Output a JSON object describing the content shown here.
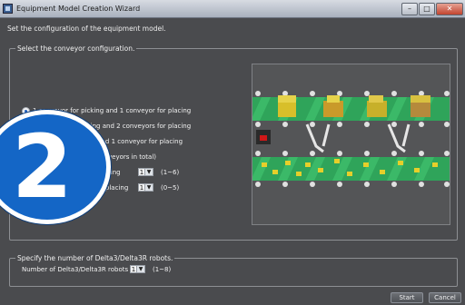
{
  "window": {
    "title": "Equipment Model Creation Wizard",
    "controls": [
      "–",
      "□",
      "✕"
    ]
  },
  "header": {
    "text": "Set the configuration of the equipment model."
  },
  "conveyor_group": {
    "label": "Select the conveyor configuration.",
    "options": [
      {
        "label": "1 conveyor for picking and 1 conveyor for placing",
        "selected": true
      },
      {
        "label": "yor for picking and 2 conveyors for placing",
        "selected": false
      },
      {
        "label": "for picking and 1 conveyor for placing",
        "selected": false
      },
      {
        "label": "(Up to 6 conveyors in total)",
        "selected": false
      }
    ],
    "picking": {
      "label": "veyors for picking",
      "value": "1",
      "range": "(1~6)"
    },
    "placing": {
      "label": "nveyors for placing",
      "value": "1",
      "range": "(0~5)"
    }
  },
  "robot_group": {
    "label": "Specify the number of Delta3/Delta3R robots.",
    "field_label": "Number of Delta3/Delta3R robots",
    "value": "1",
    "range": "(1~8)"
  },
  "badge": {
    "number": "2"
  },
  "buttons": {
    "start": "Start",
    "cancel": "Cancel"
  },
  "colors": {
    "conveyor": "#2fa45a",
    "item": "#d8bf2a",
    "badge": "#1466c6",
    "panel": "#4a4b4e"
  }
}
